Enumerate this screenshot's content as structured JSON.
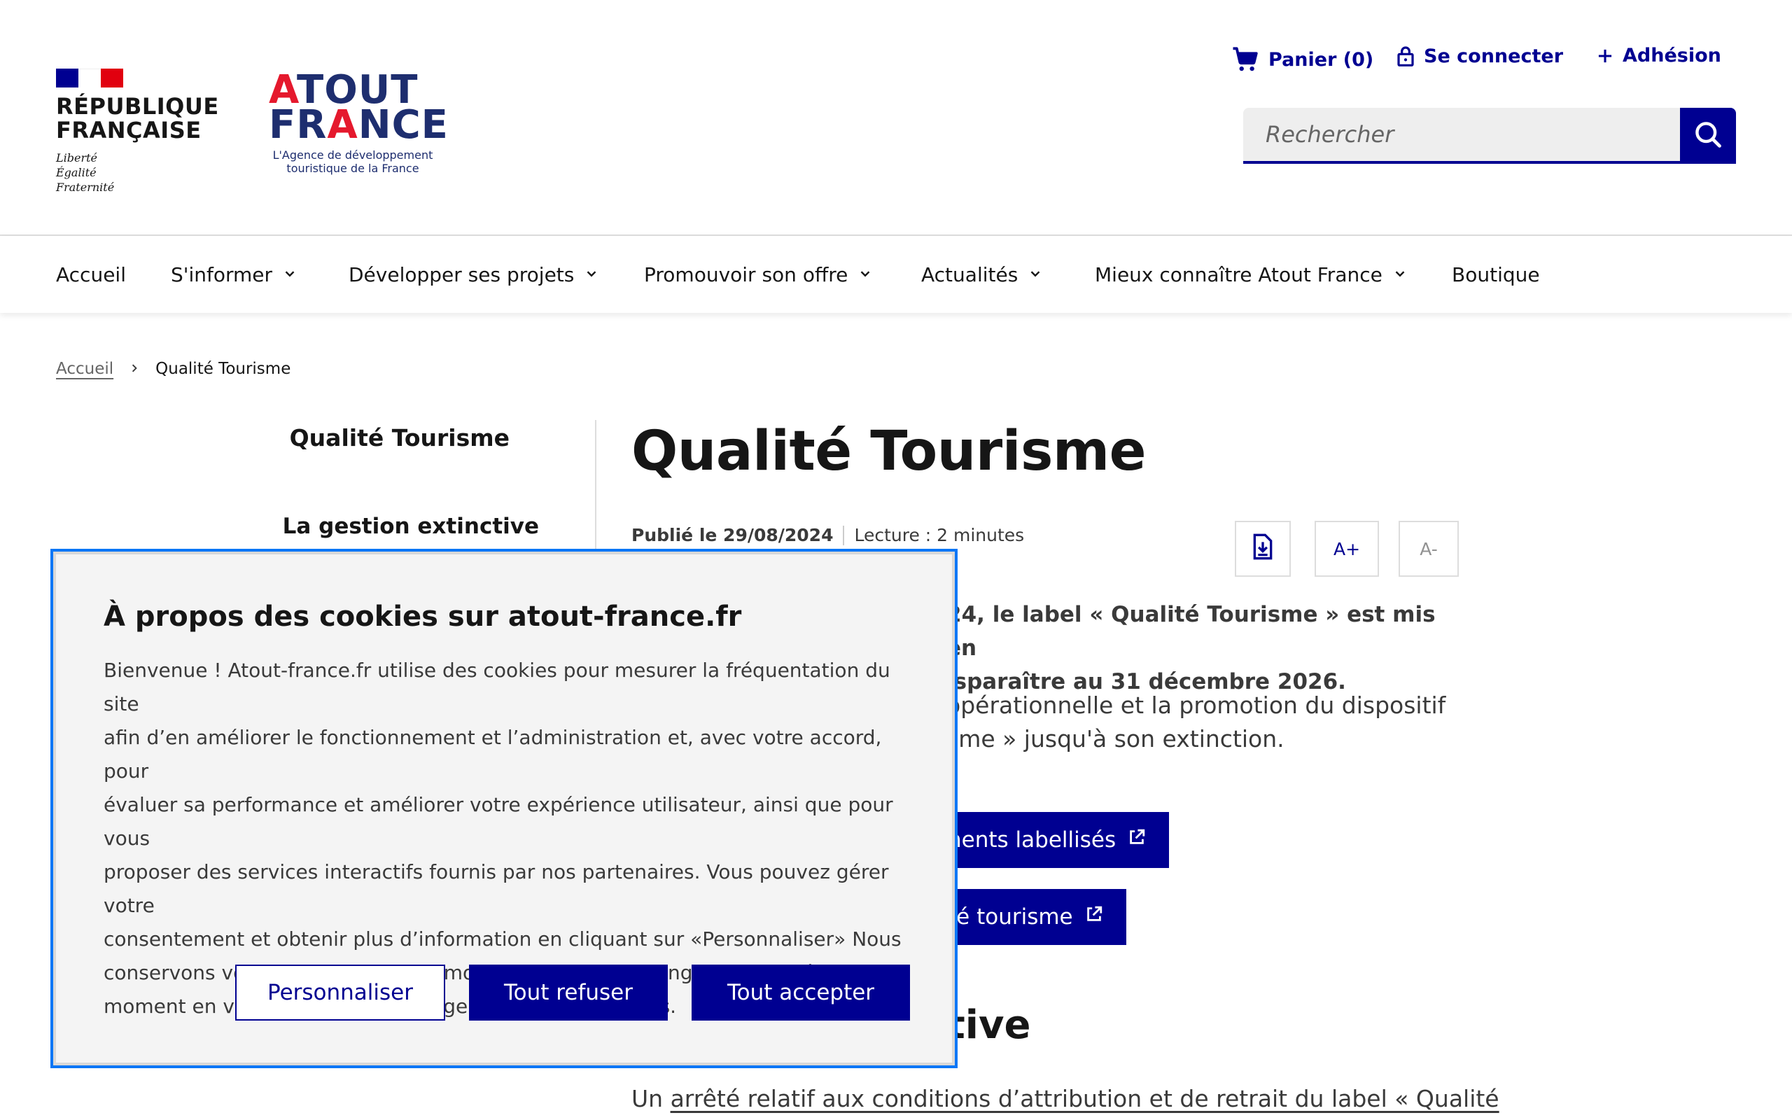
{
  "header": {
    "republique": {
      "line1": "RÉPUBLIQUE",
      "line2": "FRANÇAISE",
      "motto1": "Liberté",
      "motto2": "Égalité",
      "motto3": "Fraternité"
    },
    "atout_france": {
      "line1_red": "A",
      "line1_rest": "TOUT",
      "line2_start": "FR",
      "line2_red": "A",
      "line2_end": "NCE",
      "tagline1": "L'Agence de développement",
      "tagline2": "touristique de la France"
    },
    "tools": {
      "cart": "Panier (0)",
      "login": "Se connecter",
      "join": "Adhésion"
    },
    "search": {
      "placeholder": "Rechercher"
    }
  },
  "nav": {
    "items": [
      {
        "label": "Accueil"
      },
      {
        "label": "S'informer"
      },
      {
        "label": "Développer ses projets"
      },
      {
        "label": "Promouvoir son offre"
      },
      {
        "label": "Actualités"
      },
      {
        "label": "Mieux connaître Atout France"
      },
      {
        "label": "Boutique"
      }
    ]
  },
  "breadcrumb": {
    "home": "Accueil",
    "current": "Qualité Tourisme"
  },
  "sidemenu": {
    "title": "Qualité Tourisme",
    "item": "La gestion extinctive"
  },
  "main": {
    "title": "Qualité Tourisme",
    "published": "Publié le 29/08/2024",
    "reading": "Lecture : 2 minutes",
    "font_increase": "A+",
    "font_decrease": "A-",
    "lead_line1": "24, le label « Qualité Tourisme » est mis en",
    "lead_line2": "isparaître au 31 décembre 2026.",
    "para_line1": "opérationnelle et la promotion du dispositif",
    "para_line2": "sme » jusqu'à son extinction.",
    "cta1": "nents labellisés",
    "cta2": "té tourisme",
    "h2": "tive",
    "bottom_prefix": "Un ",
    "bottom_link": "arrêté relatif aux conditions d’attribution et de retrait du label « Qualité"
  },
  "cookie": {
    "title": "À propos des cookies sur atout-france.fr",
    "lines": [
      "Bienvenue ! Atout-france.fr utilise des cookies pour mesurer la fréquentation du site",
      "afin d’en améliorer le fonctionnement et l’administration et, avec votre accord, pour",
      "évaluer sa performance et améliorer votre expérience utilisateur, ainsi que pour vous",
      "proposer des services interactifs fournis par nos partenaires. Vous pouvez gérer votre",
      "consentement et obtenir plus d’information en cliquant sur «Personnaliser» Nous",
      "conservons votre choix pendant 6 mois. Vous pouvez changer ce choix à tout",
      "moment en vous rendant sur la page Gestion des cookies."
    ],
    "personalize": "Personnaliser",
    "refuse": "Tout refuser",
    "accept": "Tout accepter"
  },
  "colors": {
    "primary": "#000091",
    "focus": "#0a76f6",
    "brand_red": "#e5192d",
    "brand_navy": "#1e2e6f"
  }
}
